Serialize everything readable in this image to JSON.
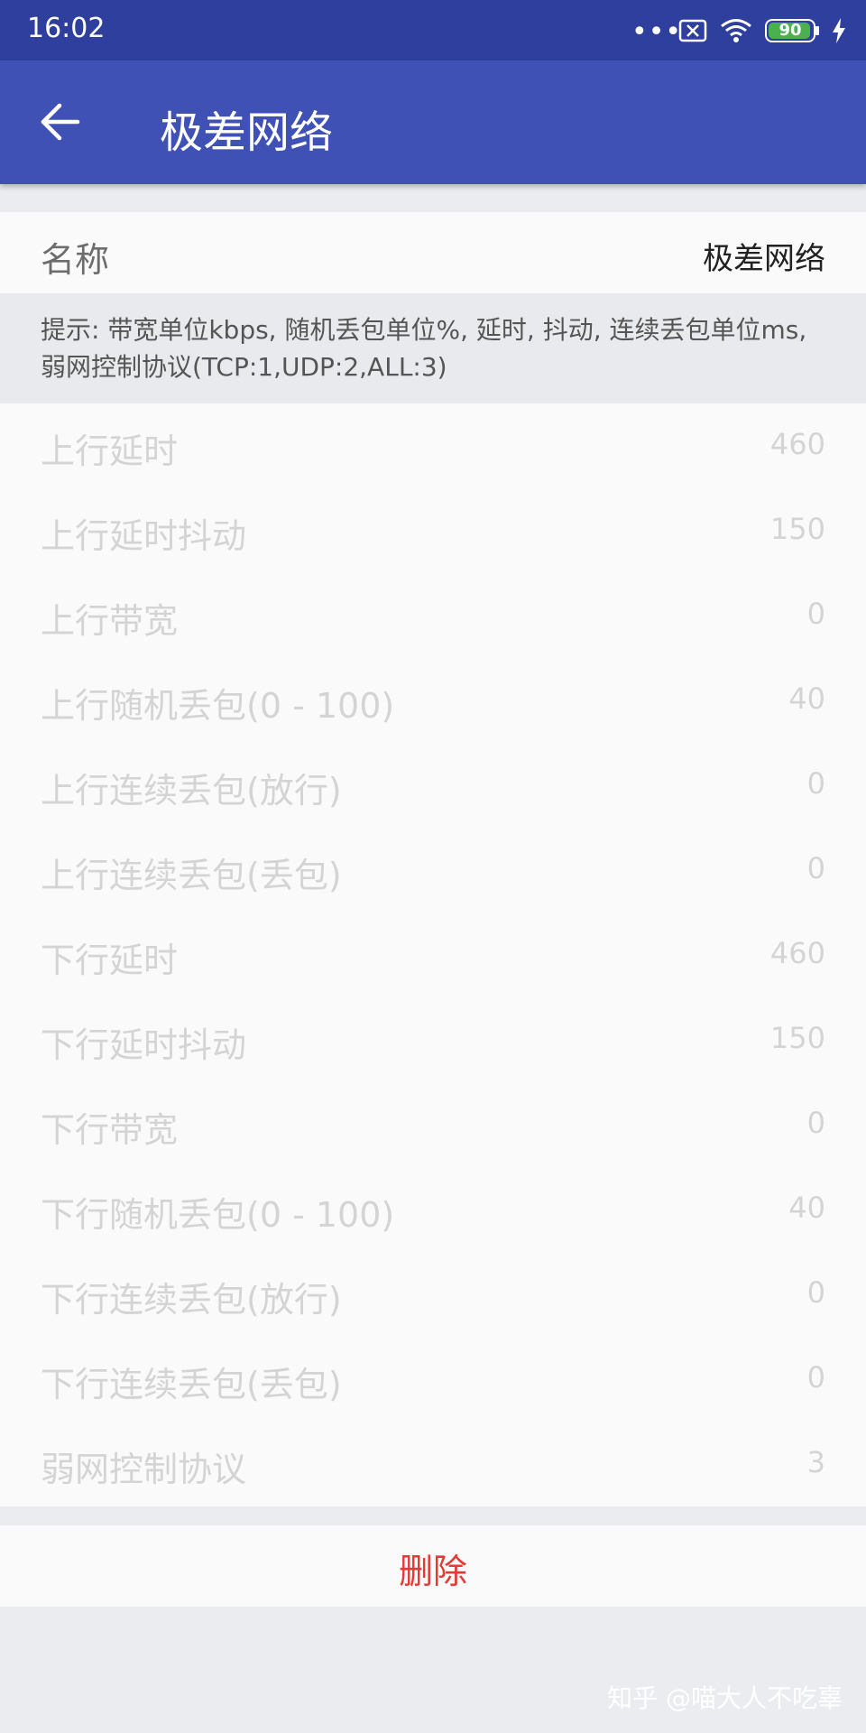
{
  "status_bar": {
    "time": "16:02",
    "dots": "•••",
    "battery": "90",
    "icons": [
      "sim-disabled-icon",
      "wifi-icon",
      "battery-icon",
      "charging-icon"
    ]
  },
  "app_bar": {
    "title": "极差网络",
    "back_icon": "arrow-back-icon"
  },
  "name_row": {
    "label": "名称",
    "value": "极差网络"
  },
  "hint": "提示: 带宽单位kbps, 随机丢包单位%, 延时, 抖动, 连续丢包单位ms, 弱网控制协议(TCP:1,UDP:2,ALL:3)",
  "params": [
    {
      "label": "上行延时",
      "value": "460"
    },
    {
      "label": "上行延时抖动",
      "value": "150"
    },
    {
      "label": "上行带宽",
      "value": "0"
    },
    {
      "label": "上行随机丢包(0 - 100)",
      "value": "40"
    },
    {
      "label": "上行连续丢包(放行)",
      "value": "0"
    },
    {
      "label": "上行连续丢包(丢包)",
      "value": "0"
    },
    {
      "label": "下行延时",
      "value": "460"
    },
    {
      "label": "下行延时抖动",
      "value": "150"
    },
    {
      "label": "下行带宽",
      "value": "0"
    },
    {
      "label": "下行随机丢包(0 - 100)",
      "value": "40"
    },
    {
      "label": "下行连续丢包(放行)",
      "value": "0"
    },
    {
      "label": "下行连续丢包(丢包)",
      "value": "0"
    },
    {
      "label": "弱网控制协议",
      "value": "3"
    }
  ],
  "delete_label": "删除",
  "watermark": "知乎 @喵大人不吃辜",
  "colors": {
    "status_bar": "#2e3f9e",
    "app_bar": "#3f51b5",
    "delete": "#e53935",
    "battery": "#4caf50"
  }
}
